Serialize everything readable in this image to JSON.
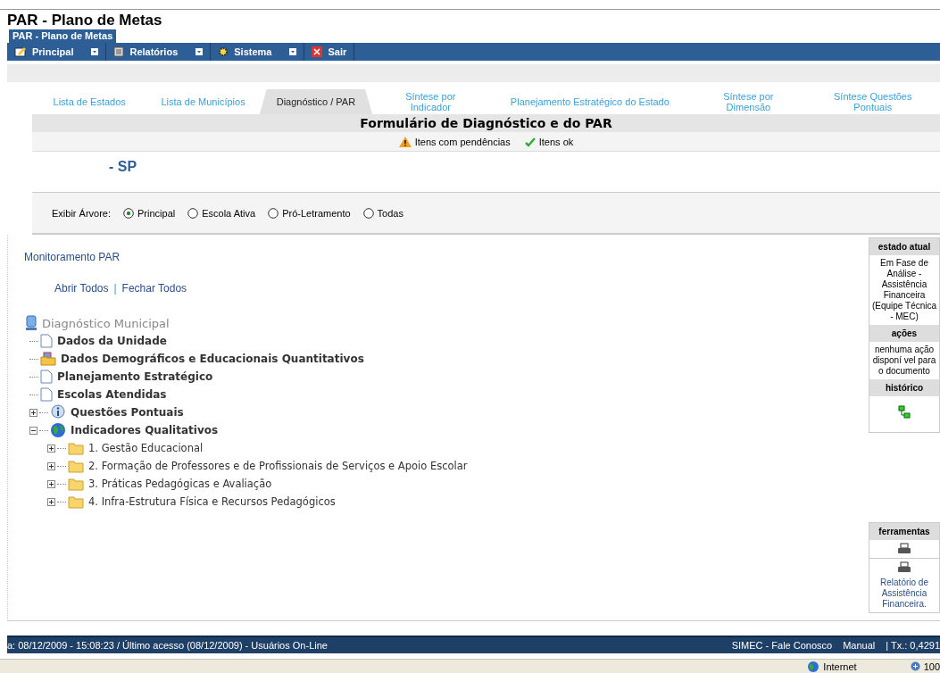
{
  "page_title": "PAR - Plano de Metas",
  "app_tab": "PAR - Plano de Metas",
  "menu": [
    {
      "label": "Principal",
      "kind": "edit"
    },
    {
      "label": "Relatórios",
      "kind": "report"
    },
    {
      "label": "Sistema",
      "kind": "gear"
    },
    {
      "label": "Sair",
      "kind": "exit"
    }
  ],
  "tabs": [
    {
      "label": "Lista de Estados",
      "selected": false
    },
    {
      "label": "Lista de Municípios",
      "selected": false
    },
    {
      "label": "Diagnóstico / PAR",
      "selected": true
    },
    {
      "label": "Síntese por Indicador",
      "selected": false
    },
    {
      "label": "Planejamento Estratégico do Estado",
      "selected": false
    },
    {
      "label": "Síntese por Dimensão",
      "selected": false
    },
    {
      "label": "Síntese Questões Pontuais",
      "selected": false
    }
  ],
  "form_title": "Formulário de Diagnóstico e do PAR",
  "legend": [
    {
      "label": "Itens com pendências",
      "kind": "warning"
    },
    {
      "label": "Itens ok",
      "kind": "ok"
    }
  ],
  "location": "- SP",
  "tree_filter": {
    "label": "Exibir Árvore:",
    "options": [
      {
        "label": "Principal",
        "selected": true
      },
      {
        "label": "Escola Ativa",
        "selected": false
      },
      {
        "label": "Pró-Letramento",
        "selected": false
      },
      {
        "label": "Todas",
        "selected": false
      }
    ]
  },
  "monitoring_link": "Monitoramento PAR",
  "expand_links": [
    "Abrir Todos",
    "Fechar Todos"
  ],
  "link_separator": "|",
  "tree": {
    "label": "Diagnóstico Municipal",
    "children": [
      {
        "label": "Dados da Unidade",
        "kind": "document"
      },
      {
        "label": "Dados Demográficos e Educacionais Quantitativos",
        "kind": "chart-folder"
      },
      {
        "label": "Planejamento Estratégico",
        "kind": "document"
      },
      {
        "label": "Escolas Atendidas",
        "kind": "document"
      },
      {
        "label": "Questões Pontuais",
        "kind": "info",
        "expanded": false
      },
      {
        "label": "Indicadores Qualitativos",
        "kind": "globe",
        "expanded": true,
        "children": [
          {
            "label": "1. Gestão Educacional",
            "kind": "folder",
            "expanded": false
          },
          {
            "label": "2. Formação de Professores e de Profissionais de Serviços e Apoio Escolar",
            "kind": "folder",
            "expanded": false
          },
          {
            "label": "3. Práticas Pedagógicas e Avaliação",
            "kind": "folder",
            "expanded": false
          },
          {
            "label": "4. Infra-Estrutura Física e Recursos Pedagógicos",
            "kind": "folder",
            "expanded": false
          }
        ]
      }
    ]
  },
  "workflow": {
    "state_heading": "estado atual",
    "state": "Em Fase de Análise - Assistência Financeira (Equipe Técnica - MEC)",
    "actions_heading": "ações",
    "actions": "nenhuma ação disponí vel para o documento",
    "history_heading": "histórico"
  },
  "tools": {
    "heading": "ferramentas",
    "report_link": "Relatório de Assistência Financeira."
  },
  "footer": {
    "session": "a: 08/12/2009 - 15:08:23 / Último acesso (08/12/2009) - Usuários On-Line",
    "links": [
      "SIMEC - Fale Conosco",
      "Manual"
    ],
    "rate": "| Tx.: 0,4291"
  },
  "browser_status": {
    "zone": "Internet",
    "zoom": "100"
  }
}
